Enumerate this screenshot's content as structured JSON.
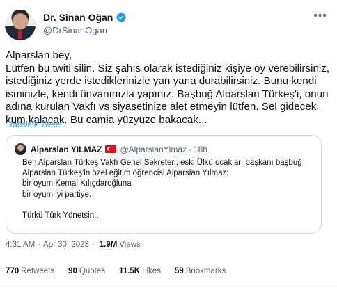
{
  "author": {
    "display_name": "Dr. Sinan Oğan",
    "handle": "@DrSinanOgan"
  },
  "tweet": {
    "text": "Alparslan bey,\nLütfen bu twiti silin. Siz şahıs olarak istediğiniz kişiye oy verebilirsiniz, istediğiniz yerde istediklerinizle yan yana durabilirsiniz. Bunu kendi isminizle, kendi ünvanınızla yapınız. Başbuğ Alparslan Türkeş'i, onun adına kurulan Vakfı vs siyasetinize alet etmeyin lütfen. Sel gidecek, kum kalacak. Bu camia yüzyüze bakacak...",
    "translate_label": "Translate Tweet"
  },
  "quote": {
    "name": "Alparslan YILMAZ",
    "handle": "@AlparslanYlmaz",
    "separator": "·",
    "time": "18h",
    "text": "Ben Alparslan Türkeş Vakfı Genel Sekreteri, eski Ülkü ocakları başkanı başbuğ Alparslan Türkeş'in özel eğitim öğrencisi Alparslan Yılmaz;\nbir oyum Kemal Kılıçdaroğluna\nbir oyum iyi partiye.\n\nTürkü Türk Yönetsin.."
  },
  "meta": {
    "time": "4:31 AM",
    "date": "Apr 30, 2023",
    "dot": "·",
    "views_count": "1.9M",
    "views_label": "Views"
  },
  "stats": {
    "retweets_count": "770",
    "retweets_label": "Retweets",
    "quotes_count": "90",
    "quotes_label": "Quotes",
    "likes_count": "11.5K",
    "likes_label": "Likes",
    "bookmarks_count": "59",
    "bookmarks_label": "Bookmarks"
  },
  "icons": {
    "verified": "verified-badge-icon",
    "more": "more-icon",
    "flag": "turkey-flag-icon"
  },
  "colors": {
    "accent": "#1d9bf0",
    "text": "#0f1419",
    "secondary": "#536471"
  }
}
